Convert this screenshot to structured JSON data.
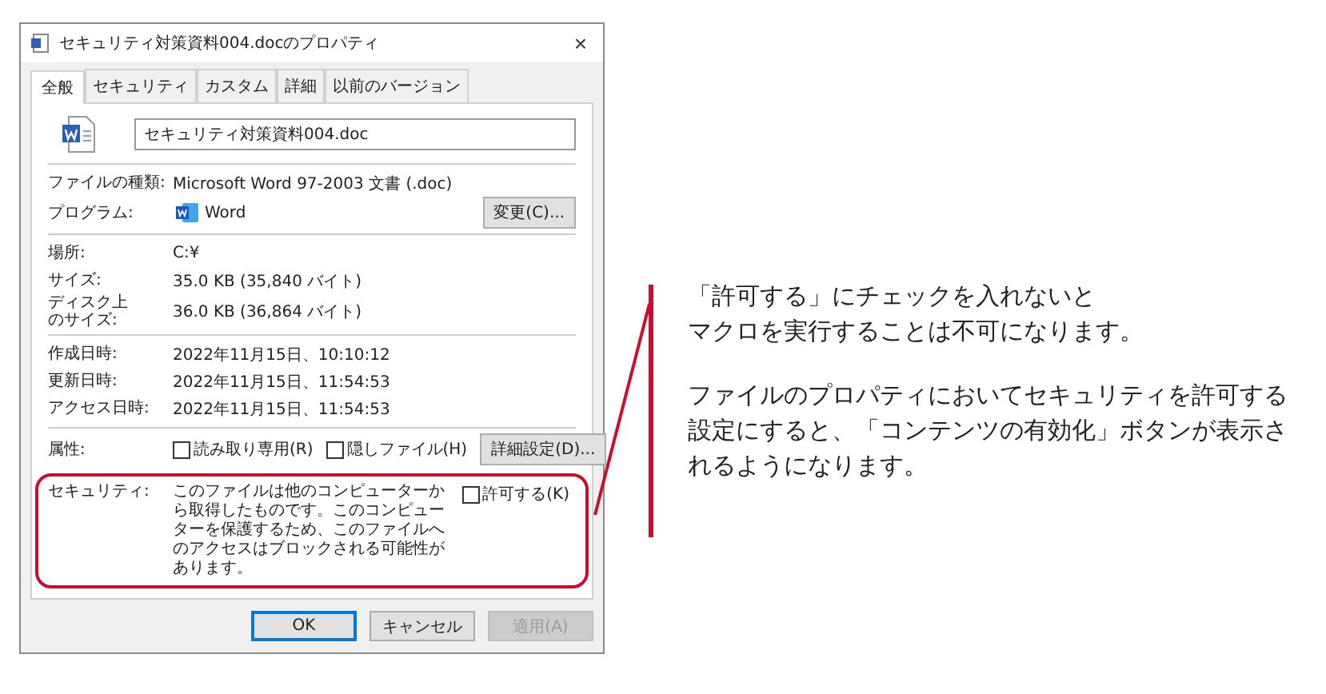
{
  "dialog": {
    "title": "セキュリティ対策資料004.docのプロパティ",
    "close": "×",
    "tabs": [
      {
        "label": "全般",
        "selected": true
      },
      {
        "label": "セキュリティ",
        "selected": false
      },
      {
        "label": "カスタム",
        "selected": false
      },
      {
        "label": "詳細",
        "selected": false
      },
      {
        "label": "以前のバージョン",
        "selected": false
      }
    ],
    "file_name": "セキュリティ対策資料004.doc",
    "file_type": {
      "label": "ファイルの種類:",
      "value": "Microsoft Word 97-2003 文書 (.doc)"
    },
    "program": {
      "label": "プログラム:",
      "value": "Word",
      "button": "変更(C)..."
    },
    "sections": [
      [
        {
          "label": "場所:",
          "value": "C:¥"
        },
        {
          "label": "サイズ:",
          "value": "35.0 KB (35,840 バイト)"
        },
        {
          "label": "ディスク上のサイズ:",
          "value": "36.0 KB (36,864 バイト)"
        }
      ],
      [
        {
          "label": "作成日時:",
          "value": "2022年11月15日、10:10:12"
        },
        {
          "label": "更新日時:",
          "value": "2022年11月15日、11:54:53"
        },
        {
          "label": "アクセス日時:",
          "value": "2022年11月15日、11:54:53"
        }
      ]
    ],
    "attributes": {
      "label": "属性:",
      "options": [
        {
          "label": "読み取り専用(R)",
          "checked": false
        },
        {
          "label": "隠しファイル(H)",
          "checked": false
        }
      ],
      "button": "詳細設定(D)..."
    },
    "security": {
      "label": "セキュリティ:",
      "text": "このファイルは他のコンピューターから取得したものです。このコンピューターを保護するため、このファイルへのアクセスはブロックされる可能性があります。",
      "option": {
        "label": "許可する(K)",
        "checked": false
      }
    },
    "buttons": [
      {
        "label": "OK",
        "default": true,
        "disabled": false
      },
      {
        "label": "キャンセル",
        "default": false,
        "disabled": false
      },
      {
        "label": "適用(A)",
        "default": false,
        "disabled": true
      }
    ]
  },
  "callout": {
    "paragraphs": [
      [
        "「許可する」にチェックを入れないと",
        "マクロを実行することは不可になります。"
      ],
      [
        "ファイルのプロパティにおいてセキュリティを許可する",
        "設定にすると、「コンテンツの有効化」ボタンが表示さ",
        "れるようになります。"
      ]
    ]
  }
}
